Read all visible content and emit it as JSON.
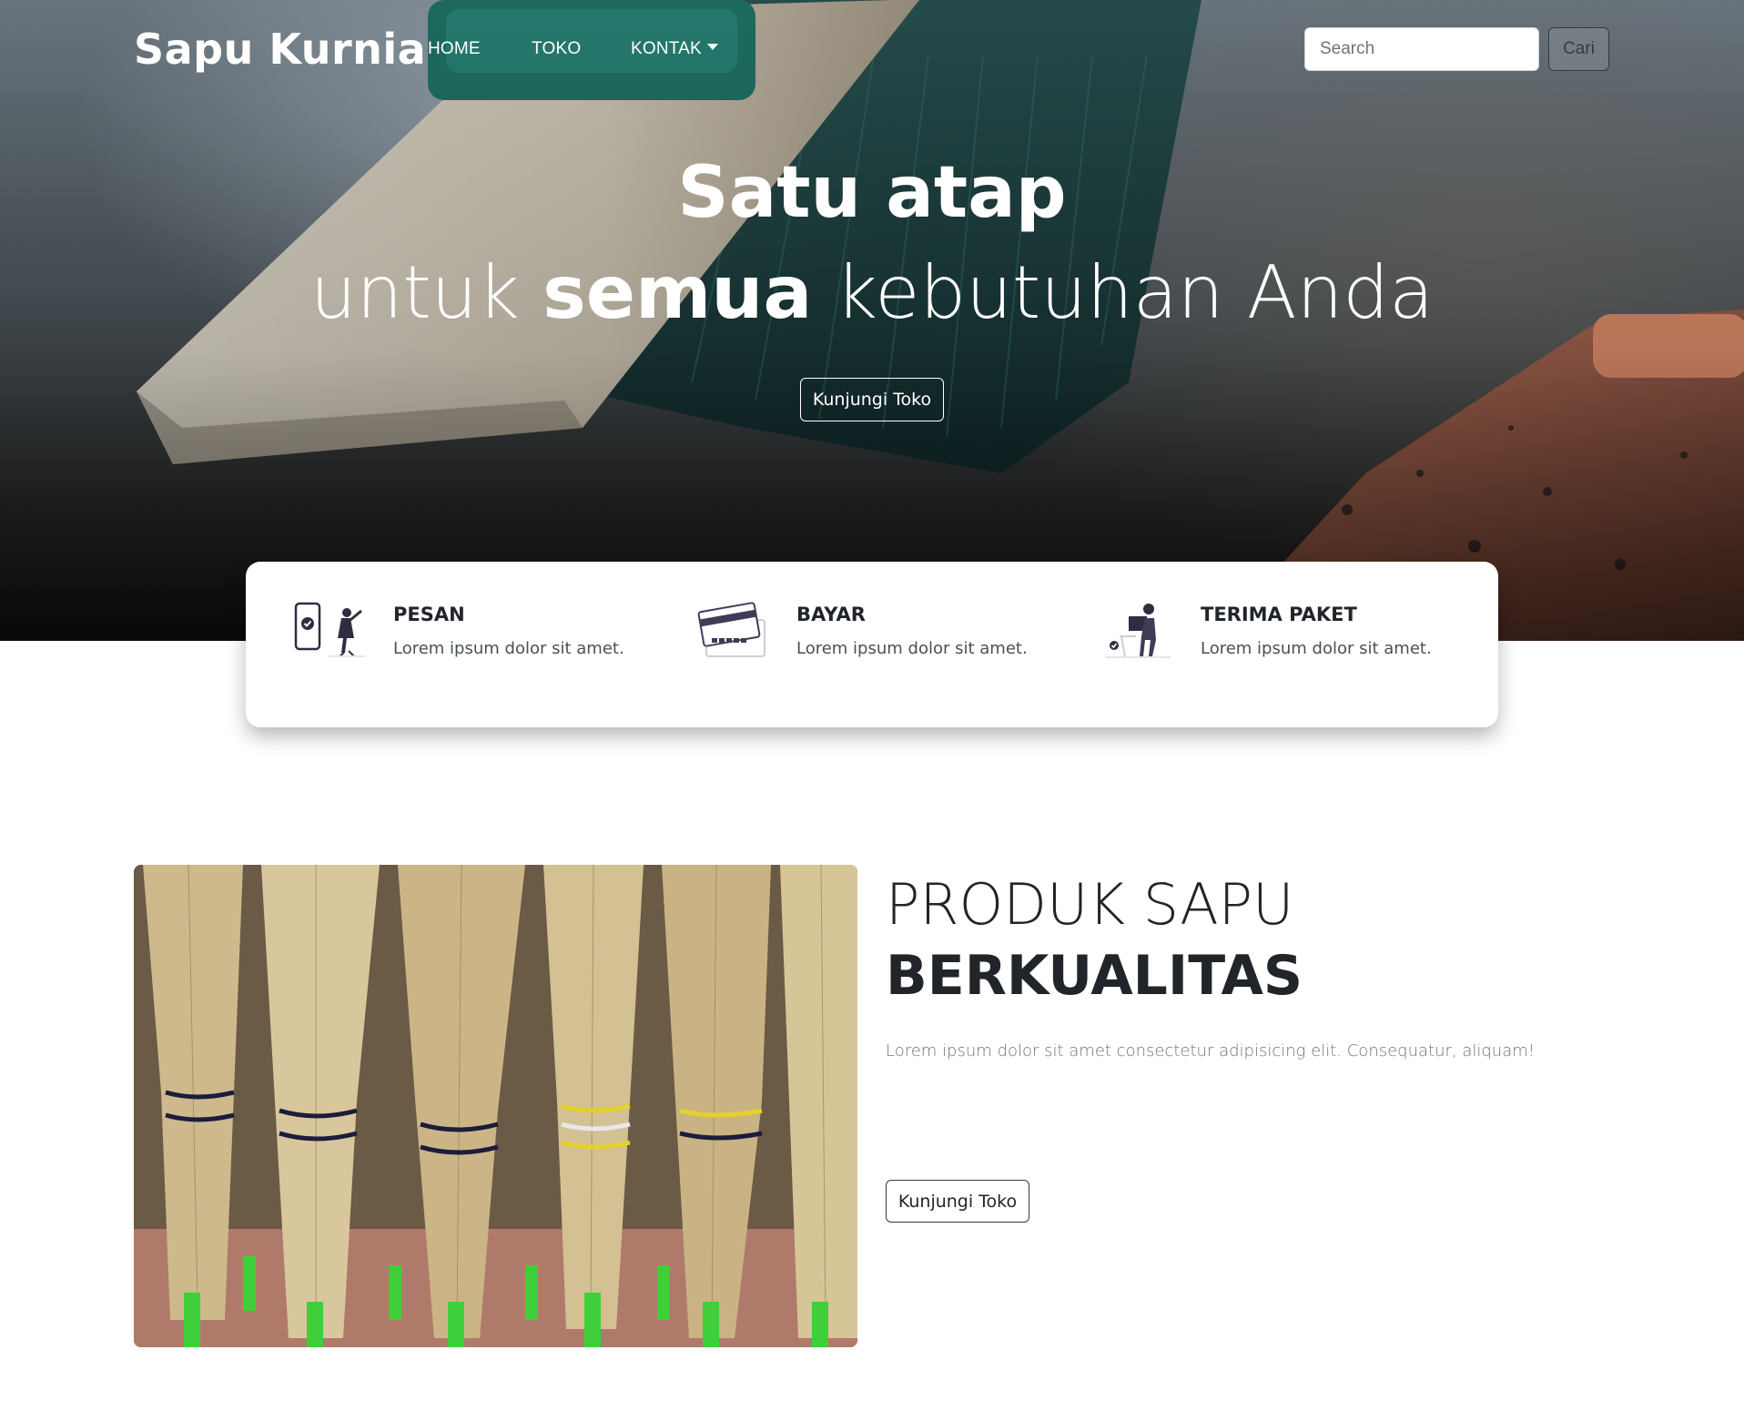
{
  "navbar": {
    "brand": "Sapu Kurnia",
    "links": [
      {
        "label": "HOME"
      },
      {
        "label": "TOKO"
      },
      {
        "label": "KONTAK"
      }
    ],
    "search_placeholder": "Search",
    "search_button": "Cari"
  },
  "hero": {
    "title": "Satu atap",
    "subtitle_pre": "untuk ",
    "subtitle_bold": "semua",
    "subtitle_post": " kebutuhan Anda",
    "button": "Kunjungi Toko",
    "background_icon": "broom-photo"
  },
  "info": [
    {
      "title": "PESAN",
      "text": "Lorem ipsum dolor sit amet.",
      "icon": "phone-order-icon"
    },
    {
      "title": "BAYAR",
      "text": "Lorem ipsum dolor sit amet.",
      "icon": "credit-card-icon"
    },
    {
      "title": "TERIMA PAKET",
      "text": "Lorem ipsum dolor sit amet.",
      "icon": "delivery-package-icon"
    }
  ],
  "product": {
    "title_light": "PRODUK SAPU",
    "title_bold": "BERKUALITAS",
    "description": "Lorem ipsum dolor sit amet consectetur adipisicing elit. Consequatur, aliquam!",
    "button": "Kunjungi Toko",
    "image": "straw-brooms-photo"
  },
  "colors": {
    "accent_teal": "#1f6f63",
    "text_dark": "#212529",
    "muted": "#6c757d"
  }
}
